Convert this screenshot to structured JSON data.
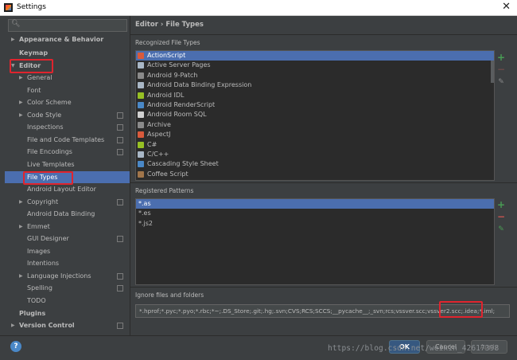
{
  "window": {
    "title": "Settings"
  },
  "search": {
    "placeholder": ""
  },
  "sidebar": {
    "items": [
      {
        "label": "Appearance & Behavior",
        "bold": true,
        "arrow": "right"
      },
      {
        "label": "Keymap",
        "bold": true
      },
      {
        "label": "Editor",
        "bold": true,
        "arrow": "down"
      },
      {
        "label": "General",
        "arrow": "right"
      },
      {
        "label": "Font"
      },
      {
        "label": "Color Scheme",
        "arrow": "right"
      },
      {
        "label": "Code Style",
        "arrow": "right",
        "config": true
      },
      {
        "label": "Inspections",
        "config": true
      },
      {
        "label": "File and Code Templates",
        "config": true
      },
      {
        "label": "File Encodings",
        "config": true
      },
      {
        "label": "Live Templates"
      },
      {
        "label": "File Types",
        "selected": true
      },
      {
        "label": "Android Layout Editor"
      },
      {
        "label": "Copyright",
        "arrow": "right",
        "config": true
      },
      {
        "label": "Android Data Binding"
      },
      {
        "label": "Emmet",
        "arrow": "right"
      },
      {
        "label": "GUI Designer",
        "config": true
      },
      {
        "label": "Images"
      },
      {
        "label": "Intentions"
      },
      {
        "label": "Language Injections",
        "arrow": "right",
        "config": true
      },
      {
        "label": "Spelling",
        "config": true
      },
      {
        "label": "TODO"
      },
      {
        "label": "Plugins",
        "bold": true
      },
      {
        "label": "Version Control",
        "bold": true,
        "arrow": "right",
        "config": true
      }
    ]
  },
  "content": {
    "breadcrumb": "Editor  ›  File Types",
    "recognized_label": "Recognized File Types",
    "file_types": [
      {
        "name": "ActionScript",
        "icon_color": "#d95a3c",
        "selected": true
      },
      {
        "name": "Active Server Pages",
        "icon_color": "#a9b7c6"
      },
      {
        "name": "Android 9-Patch",
        "icon_color": "#8a8a8a"
      },
      {
        "name": "Android Data Binding Expression",
        "icon_color": "#a9b7c6"
      },
      {
        "name": "Android IDL",
        "icon_color": "#97c024"
      },
      {
        "name": "Android RenderScript",
        "icon_color": "#4a88c7"
      },
      {
        "name": "Android Room SQL",
        "icon_color": "#d0d0d0"
      },
      {
        "name": "Archive",
        "icon_color": "#8a8a8a"
      },
      {
        "name": "AspectJ",
        "icon_color": "#d95a3c"
      },
      {
        "name": "C#",
        "icon_color": "#97c024"
      },
      {
        "name": "C/C++",
        "icon_color": "#a9b7c6"
      },
      {
        "name": "Cascading Style Sheet",
        "icon_color": "#4a88c7"
      },
      {
        "name": "Coffee Script",
        "icon_color": "#a0754a"
      }
    ],
    "patterns_label": "Registered Patterns",
    "patterns": [
      {
        "name": "*.as",
        "selected": true
      },
      {
        "name": "*.es"
      },
      {
        "name": "*.js2"
      }
    ],
    "ignore_label": "Ignore files and folders",
    "ignore_value": "*.hprof;*.pyc;*.pyo;*.rbc;*~;.DS_Store;.git;.hg;.svn;CVS;RCS;SCCS;__pycache__;_svn;rcs;vssver.scc;vssver2.scc;.idea;*.iml;"
  },
  "buttons": {
    "ok": "OK",
    "cancel": "Cancel",
    "apply": "Apply"
  },
  "help": "?",
  "watermark": "https://blog.csdn.net/weixin_42617398",
  "colors": {
    "selection": "#4b6eaf",
    "highlight": "#e0242e",
    "add": "#499c54",
    "remove": "#c75450"
  }
}
